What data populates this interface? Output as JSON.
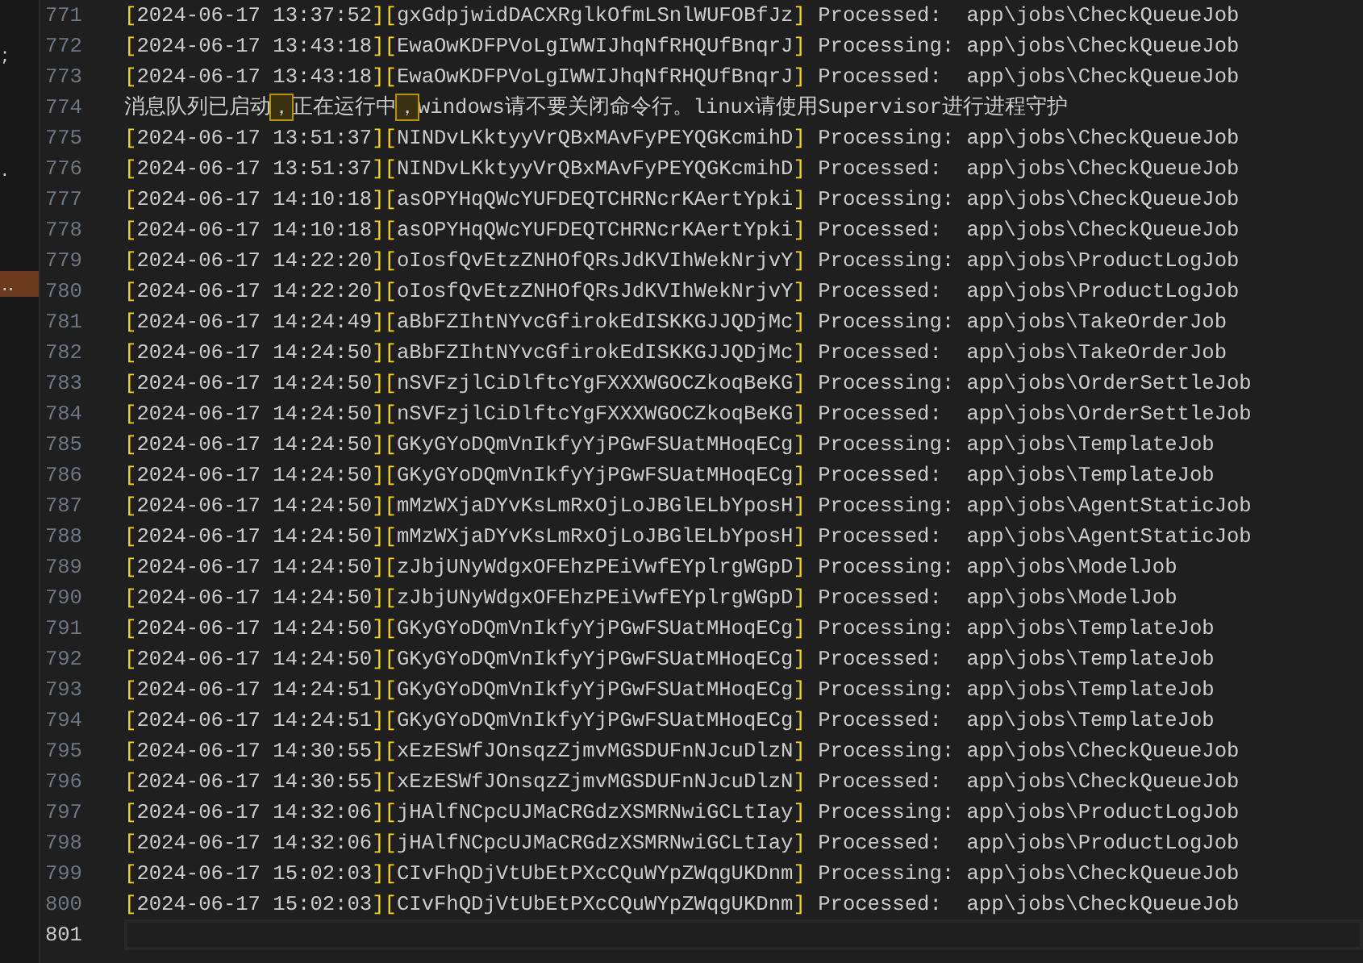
{
  "sidebar": {
    "items": [
      {
        "label": ";",
        "selected": false
      },
      {
        "label": ".",
        "selected": false
      },
      {
        "label": "..",
        "selected": true
      }
    ]
  },
  "editor": {
    "lines": [
      {
        "number": "771",
        "current": false,
        "segments": [
          {
            "kind": "bracket",
            "text": "["
          },
          {
            "kind": "text",
            "text": "2024-06-17 13:37:52"
          },
          {
            "kind": "bracket",
            "text": "]["
          },
          {
            "kind": "text",
            "text": "gxGdpjwidDACXRglkOfmLSnlWUFOBfJz"
          },
          {
            "kind": "bracket",
            "text": "]"
          },
          {
            "kind": "text",
            "text": " Processed:  app\\jobs\\CheckQueueJob"
          }
        ]
      },
      {
        "number": "772",
        "current": false,
        "segments": [
          {
            "kind": "bracket",
            "text": "["
          },
          {
            "kind": "text",
            "text": "2024-06-17 13:43:18"
          },
          {
            "kind": "bracket",
            "text": "]["
          },
          {
            "kind": "text",
            "text": "EwaOwKDFPVoLgIWWIJhqNfRHQUfBnqrJ"
          },
          {
            "kind": "bracket",
            "text": "]"
          },
          {
            "kind": "text",
            "text": " Processing: app\\jobs\\CheckQueueJob"
          }
        ]
      },
      {
        "number": "773",
        "current": false,
        "segments": [
          {
            "kind": "bracket",
            "text": "["
          },
          {
            "kind": "text",
            "text": "2024-06-17 13:43:18"
          },
          {
            "kind": "bracket",
            "text": "]["
          },
          {
            "kind": "text",
            "text": "EwaOwKDFPVoLgIWWIJhqNfRHQUfBnqrJ"
          },
          {
            "kind": "bracket",
            "text": "]"
          },
          {
            "kind": "text",
            "text": " Processed:  app\\jobs\\CheckQueueJob"
          }
        ]
      },
      {
        "number": "774",
        "current": false,
        "segments": [
          {
            "kind": "text",
            "text": "消息队列已启动"
          },
          {
            "kind": "highlight",
            "text": "，"
          },
          {
            "kind": "text",
            "text": "正在运行中"
          },
          {
            "kind": "highlight",
            "text": "，"
          },
          {
            "kind": "text",
            "text": "windows请不要关闭命令行。linux请使用Supervisor进行进程守护"
          }
        ]
      },
      {
        "number": "775",
        "current": false,
        "segments": [
          {
            "kind": "bracket",
            "text": "["
          },
          {
            "kind": "text",
            "text": "2024-06-17 13:51:37"
          },
          {
            "kind": "bracket",
            "text": "]["
          },
          {
            "kind": "text",
            "text": "NINDvLKktyyVrQBxMAvFyPEYQGKcmihD"
          },
          {
            "kind": "bracket",
            "text": "]"
          },
          {
            "kind": "text",
            "text": " Processing: app\\jobs\\CheckQueueJob"
          }
        ]
      },
      {
        "number": "776",
        "current": false,
        "segments": [
          {
            "kind": "bracket",
            "text": "["
          },
          {
            "kind": "text",
            "text": "2024-06-17 13:51:37"
          },
          {
            "kind": "bracket",
            "text": "]["
          },
          {
            "kind": "text",
            "text": "NINDvLKktyyVrQBxMAvFyPEYQGKcmihD"
          },
          {
            "kind": "bracket",
            "text": "]"
          },
          {
            "kind": "text",
            "text": " Processed:  app\\jobs\\CheckQueueJob"
          }
        ]
      },
      {
        "number": "777",
        "current": false,
        "segments": [
          {
            "kind": "bracket",
            "text": "["
          },
          {
            "kind": "text",
            "text": "2024-06-17 14:10:18"
          },
          {
            "kind": "bracket",
            "text": "]["
          },
          {
            "kind": "text",
            "text": "asOPYHqQWcYUFDEQTCHRNcrKAertYpki"
          },
          {
            "kind": "bracket",
            "text": "]"
          },
          {
            "kind": "text",
            "text": " Processing: app\\jobs\\CheckQueueJob"
          }
        ]
      },
      {
        "number": "778",
        "current": false,
        "segments": [
          {
            "kind": "bracket",
            "text": "["
          },
          {
            "kind": "text",
            "text": "2024-06-17 14:10:18"
          },
          {
            "kind": "bracket",
            "text": "]["
          },
          {
            "kind": "text",
            "text": "asOPYHqQWcYUFDEQTCHRNcrKAertYpki"
          },
          {
            "kind": "bracket",
            "text": "]"
          },
          {
            "kind": "text",
            "text": " Processed:  app\\jobs\\CheckQueueJob"
          }
        ]
      },
      {
        "number": "779",
        "current": false,
        "segments": [
          {
            "kind": "bracket",
            "text": "["
          },
          {
            "kind": "text",
            "text": "2024-06-17 14:22:20"
          },
          {
            "kind": "bracket",
            "text": "]["
          },
          {
            "kind": "text",
            "text": "oIosfQvEtzZNHOfQRsJdKVIhWekNrjvY"
          },
          {
            "kind": "bracket",
            "text": "]"
          },
          {
            "kind": "text",
            "text": " Processing: app\\jobs\\ProductLogJob"
          }
        ]
      },
      {
        "number": "780",
        "current": false,
        "segments": [
          {
            "kind": "bracket",
            "text": "["
          },
          {
            "kind": "text",
            "text": "2024-06-17 14:22:20"
          },
          {
            "kind": "bracket",
            "text": "]["
          },
          {
            "kind": "text",
            "text": "oIosfQvEtzZNHOfQRsJdKVIhWekNrjvY"
          },
          {
            "kind": "bracket",
            "text": "]"
          },
          {
            "kind": "text",
            "text": " Processed:  app\\jobs\\ProductLogJob"
          }
        ]
      },
      {
        "number": "781",
        "current": false,
        "segments": [
          {
            "kind": "bracket",
            "text": "["
          },
          {
            "kind": "text",
            "text": "2024-06-17 14:24:49"
          },
          {
            "kind": "bracket",
            "text": "]["
          },
          {
            "kind": "text",
            "text": "aBbFZIhtNYvcGfirokEdISKKGJJQDjMc"
          },
          {
            "kind": "bracket",
            "text": "]"
          },
          {
            "kind": "text",
            "text": " Processing: app\\jobs\\TakeOrderJob"
          }
        ]
      },
      {
        "number": "782",
        "current": false,
        "segments": [
          {
            "kind": "bracket",
            "text": "["
          },
          {
            "kind": "text",
            "text": "2024-06-17 14:24:50"
          },
          {
            "kind": "bracket",
            "text": "]["
          },
          {
            "kind": "text",
            "text": "aBbFZIhtNYvcGfirokEdISKKGJJQDjMc"
          },
          {
            "kind": "bracket",
            "text": "]"
          },
          {
            "kind": "text",
            "text": " Processed:  app\\jobs\\TakeOrderJob"
          }
        ]
      },
      {
        "number": "783",
        "current": false,
        "segments": [
          {
            "kind": "bracket",
            "text": "["
          },
          {
            "kind": "text",
            "text": "2024-06-17 14:24:50"
          },
          {
            "kind": "bracket",
            "text": "]["
          },
          {
            "kind": "text",
            "text": "nSVFzjlCiDlftcYgFXXXWGOCZkoqBeKG"
          },
          {
            "kind": "bracket",
            "text": "]"
          },
          {
            "kind": "text",
            "text": " Processing: app\\jobs\\OrderSettleJob"
          }
        ]
      },
      {
        "number": "784",
        "current": false,
        "segments": [
          {
            "kind": "bracket",
            "text": "["
          },
          {
            "kind": "text",
            "text": "2024-06-17 14:24:50"
          },
          {
            "kind": "bracket",
            "text": "]["
          },
          {
            "kind": "text",
            "text": "nSVFzjlCiDlftcYgFXXXWGOCZkoqBeKG"
          },
          {
            "kind": "bracket",
            "text": "]"
          },
          {
            "kind": "text",
            "text": " Processed:  app\\jobs\\OrderSettleJob"
          }
        ]
      },
      {
        "number": "785",
        "current": false,
        "segments": [
          {
            "kind": "bracket",
            "text": "["
          },
          {
            "kind": "text",
            "text": "2024-06-17 14:24:50"
          },
          {
            "kind": "bracket",
            "text": "]["
          },
          {
            "kind": "text",
            "text": "GKyGYoDQmVnIkfyYjPGwFSUatMHoqECg"
          },
          {
            "kind": "bracket",
            "text": "]"
          },
          {
            "kind": "text",
            "text": " Processing: app\\jobs\\TemplateJob"
          }
        ]
      },
      {
        "number": "786",
        "current": false,
        "segments": [
          {
            "kind": "bracket",
            "text": "["
          },
          {
            "kind": "text",
            "text": "2024-06-17 14:24:50"
          },
          {
            "kind": "bracket",
            "text": "]["
          },
          {
            "kind": "text",
            "text": "GKyGYoDQmVnIkfyYjPGwFSUatMHoqECg"
          },
          {
            "kind": "bracket",
            "text": "]"
          },
          {
            "kind": "text",
            "text": " Processed:  app\\jobs\\TemplateJob"
          }
        ]
      },
      {
        "number": "787",
        "current": false,
        "segments": [
          {
            "kind": "bracket",
            "text": "["
          },
          {
            "kind": "text",
            "text": "2024-06-17 14:24:50"
          },
          {
            "kind": "bracket",
            "text": "]["
          },
          {
            "kind": "text",
            "text": "mMzWXjaDYvKsLmRxOjLoJBGlELbYposH"
          },
          {
            "kind": "bracket",
            "text": "]"
          },
          {
            "kind": "text",
            "text": " Processing: app\\jobs\\AgentStaticJob"
          }
        ]
      },
      {
        "number": "788",
        "current": false,
        "segments": [
          {
            "kind": "bracket",
            "text": "["
          },
          {
            "kind": "text",
            "text": "2024-06-17 14:24:50"
          },
          {
            "kind": "bracket",
            "text": "]["
          },
          {
            "kind": "text",
            "text": "mMzWXjaDYvKsLmRxOjLoJBGlELbYposH"
          },
          {
            "kind": "bracket",
            "text": "]"
          },
          {
            "kind": "text",
            "text": " Processed:  app\\jobs\\AgentStaticJob"
          }
        ]
      },
      {
        "number": "789",
        "current": false,
        "segments": [
          {
            "kind": "bracket",
            "text": "["
          },
          {
            "kind": "text",
            "text": "2024-06-17 14:24:50"
          },
          {
            "kind": "bracket",
            "text": "]["
          },
          {
            "kind": "text",
            "text": "zJbjUNyWdgxOFEhzPEiVwfEYplrgWGpD"
          },
          {
            "kind": "bracket",
            "text": "]"
          },
          {
            "kind": "text",
            "text": " Processing: app\\jobs\\ModelJob"
          }
        ]
      },
      {
        "number": "790",
        "current": false,
        "segments": [
          {
            "kind": "bracket",
            "text": "["
          },
          {
            "kind": "text",
            "text": "2024-06-17 14:24:50"
          },
          {
            "kind": "bracket",
            "text": "]["
          },
          {
            "kind": "text",
            "text": "zJbjUNyWdgxOFEhzPEiVwfEYplrgWGpD"
          },
          {
            "kind": "bracket",
            "text": "]"
          },
          {
            "kind": "text",
            "text": " Processed:  app\\jobs\\ModelJob"
          }
        ]
      },
      {
        "number": "791",
        "current": false,
        "segments": [
          {
            "kind": "bracket",
            "text": "["
          },
          {
            "kind": "text",
            "text": "2024-06-17 14:24:50"
          },
          {
            "kind": "bracket",
            "text": "]["
          },
          {
            "kind": "text",
            "text": "GKyGYoDQmVnIkfyYjPGwFSUatMHoqECg"
          },
          {
            "kind": "bracket",
            "text": "]"
          },
          {
            "kind": "text",
            "text": " Processing: app\\jobs\\TemplateJob"
          }
        ]
      },
      {
        "number": "792",
        "current": false,
        "segments": [
          {
            "kind": "bracket",
            "text": "["
          },
          {
            "kind": "text",
            "text": "2024-06-17 14:24:50"
          },
          {
            "kind": "bracket",
            "text": "]["
          },
          {
            "kind": "text",
            "text": "GKyGYoDQmVnIkfyYjPGwFSUatMHoqECg"
          },
          {
            "kind": "bracket",
            "text": "]"
          },
          {
            "kind": "text",
            "text": " Processed:  app\\jobs\\TemplateJob"
          }
        ]
      },
      {
        "number": "793",
        "current": false,
        "segments": [
          {
            "kind": "bracket",
            "text": "["
          },
          {
            "kind": "text",
            "text": "2024-06-17 14:24:51"
          },
          {
            "kind": "bracket",
            "text": "]["
          },
          {
            "kind": "text",
            "text": "GKyGYoDQmVnIkfyYjPGwFSUatMHoqECg"
          },
          {
            "kind": "bracket",
            "text": "]"
          },
          {
            "kind": "text",
            "text": " Processing: app\\jobs\\TemplateJob"
          }
        ]
      },
      {
        "number": "794",
        "current": false,
        "segments": [
          {
            "kind": "bracket",
            "text": "["
          },
          {
            "kind": "text",
            "text": "2024-06-17 14:24:51"
          },
          {
            "kind": "bracket",
            "text": "]["
          },
          {
            "kind": "text",
            "text": "GKyGYoDQmVnIkfyYjPGwFSUatMHoqECg"
          },
          {
            "kind": "bracket",
            "text": "]"
          },
          {
            "kind": "text",
            "text": " Processed:  app\\jobs\\TemplateJob"
          }
        ]
      },
      {
        "number": "795",
        "current": false,
        "segments": [
          {
            "kind": "bracket",
            "text": "["
          },
          {
            "kind": "text",
            "text": "2024-06-17 14:30:55"
          },
          {
            "kind": "bracket",
            "text": "]["
          },
          {
            "kind": "text",
            "text": "xEzESWfJOnsqzZjmvMGSDUFnNJcuDlzN"
          },
          {
            "kind": "bracket",
            "text": "]"
          },
          {
            "kind": "text",
            "text": " Processing: app\\jobs\\CheckQueueJob"
          }
        ]
      },
      {
        "number": "796",
        "current": false,
        "segments": [
          {
            "kind": "bracket",
            "text": "["
          },
          {
            "kind": "text",
            "text": "2024-06-17 14:30:55"
          },
          {
            "kind": "bracket",
            "text": "]["
          },
          {
            "kind": "text",
            "text": "xEzESWfJOnsqzZjmvMGSDUFnNJcuDlzN"
          },
          {
            "kind": "bracket",
            "text": "]"
          },
          {
            "kind": "text",
            "text": " Processed:  app\\jobs\\CheckQueueJob"
          }
        ]
      },
      {
        "number": "797",
        "current": false,
        "segments": [
          {
            "kind": "bracket",
            "text": "["
          },
          {
            "kind": "text",
            "text": "2024-06-17 14:32:06"
          },
          {
            "kind": "bracket",
            "text": "]["
          },
          {
            "kind": "text",
            "text": "jHAlfNCpcUJMaCRGdzXSMRNwiGCLtIay"
          },
          {
            "kind": "bracket",
            "text": "]"
          },
          {
            "kind": "text",
            "text": " Processing: app\\jobs\\ProductLogJob"
          }
        ]
      },
      {
        "number": "798",
        "current": false,
        "segments": [
          {
            "kind": "bracket",
            "text": "["
          },
          {
            "kind": "text",
            "text": "2024-06-17 14:32:06"
          },
          {
            "kind": "bracket",
            "text": "]["
          },
          {
            "kind": "text",
            "text": "jHAlfNCpcUJMaCRGdzXSMRNwiGCLtIay"
          },
          {
            "kind": "bracket",
            "text": "]"
          },
          {
            "kind": "text",
            "text": " Processed:  app\\jobs\\ProductLogJob"
          }
        ]
      },
      {
        "number": "799",
        "current": false,
        "segments": [
          {
            "kind": "bracket",
            "text": "["
          },
          {
            "kind": "text",
            "text": "2024-06-17 15:02:03"
          },
          {
            "kind": "bracket",
            "text": "]["
          },
          {
            "kind": "text",
            "text": "CIvFhQDjVtUbEtPXcCQuWYpZWqgUKDnm"
          },
          {
            "kind": "bracket",
            "text": "]"
          },
          {
            "kind": "text",
            "text": " Processing: app\\jobs\\CheckQueueJob"
          }
        ]
      },
      {
        "number": "800",
        "current": false,
        "segments": [
          {
            "kind": "bracket",
            "text": "["
          },
          {
            "kind": "text",
            "text": "2024-06-17 15:02:03"
          },
          {
            "kind": "bracket",
            "text": "]["
          },
          {
            "kind": "text",
            "text": "CIvFhQDjVtUbEtPXcCQuWYpZWqgUKDnm"
          },
          {
            "kind": "bracket",
            "text": "]"
          },
          {
            "kind": "text",
            "text": " Processed:  app\\jobs\\CheckQueueJob"
          }
        ]
      },
      {
        "number": "801",
        "current": true
      }
    ]
  }
}
